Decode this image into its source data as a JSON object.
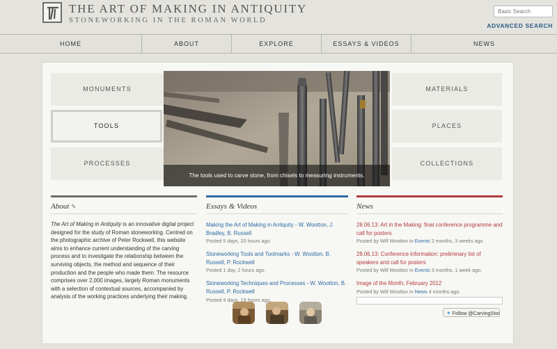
{
  "header": {
    "title": "THE ART OF MAKING IN ANTIQUITY",
    "subtitle": "STONEWORKING IN THE ROMAN WORLD",
    "search_placeholder": "Basic Search",
    "advanced_search": "ADVANCED SEARCH"
  },
  "nav": [
    {
      "label": "HOME"
    },
    {
      "label": "ABOUT"
    },
    {
      "label": "EXPLORE"
    },
    {
      "label": "ESSAYS & VIDEOS"
    },
    {
      "label": "NEWS"
    }
  ],
  "categories": {
    "monuments": "MONUMENTS",
    "tools": "TOOLS",
    "processes": "PROCESSES",
    "materials": "MATERIALS",
    "places": "PLACES",
    "collections": "COLLECTIONS",
    "active": "tools"
  },
  "hero": {
    "caption": "The tools used to carve stone, from chisels to measuring instruments."
  },
  "about": {
    "title": "About",
    "text_italic": "The Art of Making in Antiquity",
    "text_rest": " is an innovative digital project designed for the study of Roman stoneworking. Centred on the photographic archive of Peter Rockwell, this website aims to enhance current understanding of the carving process and to investigate the relationship between the surviving objects, the method and sequence of their production and the people who made them. The resource comprises over 2,000 images, largely Roman monuments with a selection of contextual sources, accompanied by analysis of the working practices underlying their making."
  },
  "essays": {
    "title": "Essays & Videos",
    "posts": [
      {
        "title": "Making the Art of Making in Antiquity - W. Wootton, J. Bradley, B. Russell",
        "meta": "Posted 5 days, 20 hours ago."
      },
      {
        "title": "Stoneworking Tools and Toolmarks - W. Wootton, B. Russell, P. Rockwell",
        "meta": "Posted 1 day, 2 hours ago."
      },
      {
        "title": "Stoneworking Techniques and Processes - W. Wootton, B. Russell, P. Rockwell",
        "meta": "Posted 4 days, 19 hours ago."
      }
    ]
  },
  "news": {
    "title": "News",
    "items": [
      {
        "title": "28.06.13: Art in the Making: final conference programme and call for posters",
        "meta_prefix": "Posted by Will Wootton in ",
        "category": "Events",
        "meta_suffix": " 2 months, 3 weeks ago"
      },
      {
        "title": "28.06.13: Conference information: preliminary list of speakers and call for posters",
        "meta_prefix": "Posted by Will Wootton in ",
        "category": "Events",
        "meta_suffix": " 3 months, 1 week ago."
      },
      {
        "title": "Image of the Month, February 2012",
        "meta_prefix": "Posted by Will Wootton in ",
        "category": "News",
        "meta_suffix": " 4 months ago."
      }
    ],
    "follow_label": "Follow @CarvingStones"
  },
  "colors": {
    "about_rule": "#6e6e6e",
    "essays_rule": "#2d6aa3",
    "news_rule": "#b23a3a",
    "link_blue": "#2d6aa3",
    "link_red": "#b23a3a"
  }
}
